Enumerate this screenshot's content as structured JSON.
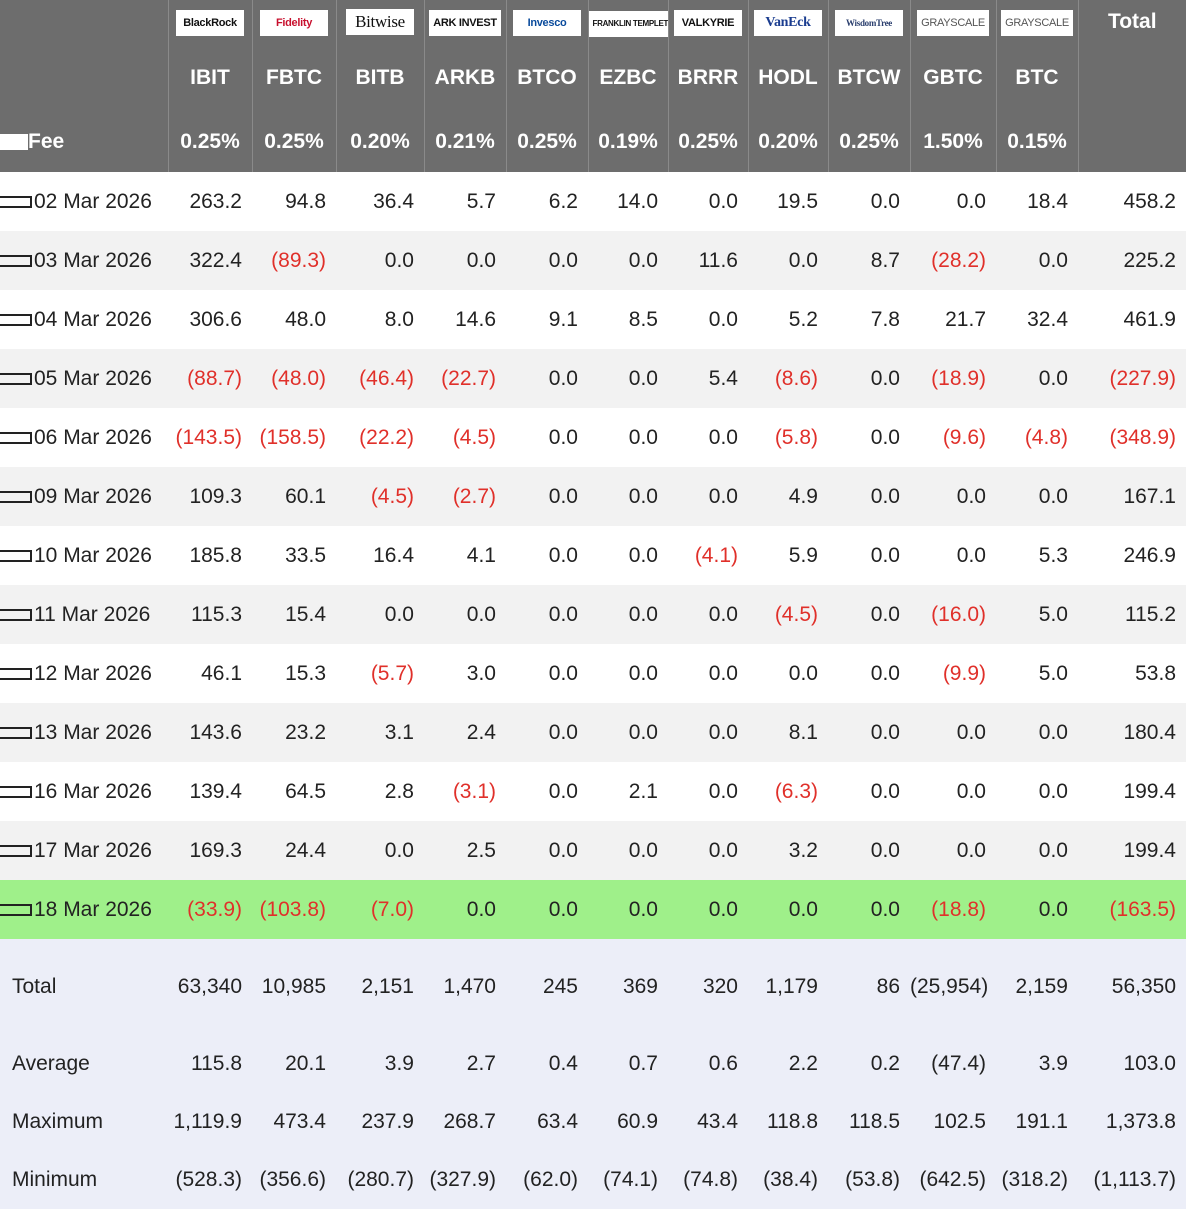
{
  "header": {
    "logos": [
      "BlackRock",
      "Fidelity",
      "Bitwise",
      "ARK INVEST",
      "Invesco",
      "FRANKLIN TEMPLETON",
      "VALKYRIE",
      "VanEck",
      "WisdomTree",
      "GRAYSCALE",
      "GRAYSCALE"
    ],
    "total_label": "Total",
    "tickers": [
      "IBIT",
      "FBTC",
      "BITB",
      "ARKB",
      "BTCO",
      "EZBC",
      "BRRR",
      "HODL",
      "BTCW",
      "GBTC",
      "BTC"
    ],
    "fee_label": "Fee",
    "fees": [
      "0.25%",
      "0.25%",
      "0.20%",
      "0.21%",
      "0.25%",
      "0.19%",
      "0.25%",
      "0.20%",
      "0.25%",
      "1.50%",
      "0.15%"
    ]
  },
  "rows": [
    {
      "date": "02 Mar 2026",
      "values": [
        "263.2",
        "94.8",
        "36.4",
        "5.7",
        "6.2",
        "14.0",
        "0.0",
        "19.5",
        "0.0",
        "0.0",
        "18.4",
        "458.2"
      ]
    },
    {
      "date": "03 Mar 2026",
      "values": [
        "322.4",
        "(89.3)",
        "0.0",
        "0.0",
        "0.0",
        "0.0",
        "11.6",
        "0.0",
        "8.7",
        "(28.2)",
        "0.0",
        "225.2"
      ]
    },
    {
      "date": "04 Mar 2026",
      "values": [
        "306.6",
        "48.0",
        "8.0",
        "14.6",
        "9.1",
        "8.5",
        "0.0",
        "5.2",
        "7.8",
        "21.7",
        "32.4",
        "461.9"
      ]
    },
    {
      "date": "05 Mar 2026",
      "values": [
        "(88.7)",
        "(48.0)",
        "(46.4)",
        "(22.7)",
        "0.0",
        "0.0",
        "5.4",
        "(8.6)",
        "0.0",
        "(18.9)",
        "0.0",
        "(227.9)"
      ]
    },
    {
      "date": "06 Mar 2026",
      "values": [
        "(143.5)",
        "(158.5)",
        "(22.2)",
        "(4.5)",
        "0.0",
        "0.0",
        "0.0",
        "(5.8)",
        "0.0",
        "(9.6)",
        "(4.8)",
        "(348.9)"
      ]
    },
    {
      "date": "09 Mar 2026",
      "values": [
        "109.3",
        "60.1",
        "(4.5)",
        "(2.7)",
        "0.0",
        "0.0",
        "0.0",
        "4.9",
        "0.0",
        "0.0",
        "0.0",
        "167.1"
      ]
    },
    {
      "date": "10 Mar 2026",
      "values": [
        "185.8",
        "33.5",
        "16.4",
        "4.1",
        "0.0",
        "0.0",
        "(4.1)",
        "5.9",
        "0.0",
        "0.0",
        "5.3",
        "246.9"
      ]
    },
    {
      "date": "11 Mar 2026",
      "values": [
        "115.3",
        "15.4",
        "0.0",
        "0.0",
        "0.0",
        "0.0",
        "0.0",
        "(4.5)",
        "0.0",
        "(16.0)",
        "5.0",
        "115.2"
      ]
    },
    {
      "date": "12 Mar 2026",
      "values": [
        "46.1",
        "15.3",
        "(5.7)",
        "3.0",
        "0.0",
        "0.0",
        "0.0",
        "0.0",
        "0.0",
        "(9.9)",
        "5.0",
        "53.8"
      ]
    },
    {
      "date": "13 Mar 2026",
      "values": [
        "143.6",
        "23.2",
        "3.1",
        "2.4",
        "0.0",
        "0.0",
        "0.0",
        "8.1",
        "0.0",
        "0.0",
        "0.0",
        "180.4"
      ]
    },
    {
      "date": "16 Mar 2026",
      "values": [
        "139.4",
        "64.5",
        "2.8",
        "(3.1)",
        "0.0",
        "2.1",
        "0.0",
        "(6.3)",
        "0.0",
        "0.0",
        "0.0",
        "199.4"
      ]
    },
    {
      "date": "17 Mar 2026",
      "values": [
        "169.3",
        "24.4",
        "0.0",
        "2.5",
        "0.0",
        "0.0",
        "0.0",
        "3.2",
        "0.0",
        "0.0",
        "0.0",
        "199.4"
      ]
    },
    {
      "date": "18 Mar 2026",
      "values": [
        "(33.9)",
        "(103.8)",
        "(7.0)",
        "0.0",
        "0.0",
        "0.0",
        "0.0",
        "0.0",
        "0.0",
        "(18.8)",
        "0.0",
        "(163.5)"
      ],
      "highlight": true
    }
  ],
  "summary": [
    {
      "label": "Total",
      "values": [
        "63,340",
        "10,985",
        "2,151",
        "1,470",
        "245",
        "369",
        "320",
        "1,179",
        "86",
        "(25,954)",
        "2,159",
        "56,350"
      ]
    },
    {
      "label": "Average",
      "values": [
        "115.8",
        "20.1",
        "3.9",
        "2.7",
        "0.4",
        "0.7",
        "0.6",
        "2.2",
        "0.2",
        "(47.4)",
        "3.9",
        "103.0"
      ]
    },
    {
      "label": "Maximum",
      "values": [
        "1,119.9",
        "473.4",
        "237.9",
        "268.7",
        "63.4",
        "60.9",
        "43.4",
        "118.8",
        "118.5",
        "102.5",
        "191.1",
        "1,373.8"
      ]
    },
    {
      "label": "Minimum",
      "values": [
        "(528.3)",
        "(356.6)",
        "(280.7)",
        "(327.9)",
        "(62.0)",
        "(74.1)",
        "(74.8)",
        "(38.4)",
        "(53.8)",
        "(642.5)",
        "(318.2)",
        "(1,113.7)"
      ]
    }
  ],
  "colors": {
    "header_bg": "#6d6d6d",
    "negative": "#e0302a",
    "highlight": "#9ff08a",
    "summary_bg": "#eceef8",
    "alt_row": "#f2f2f2"
  }
}
